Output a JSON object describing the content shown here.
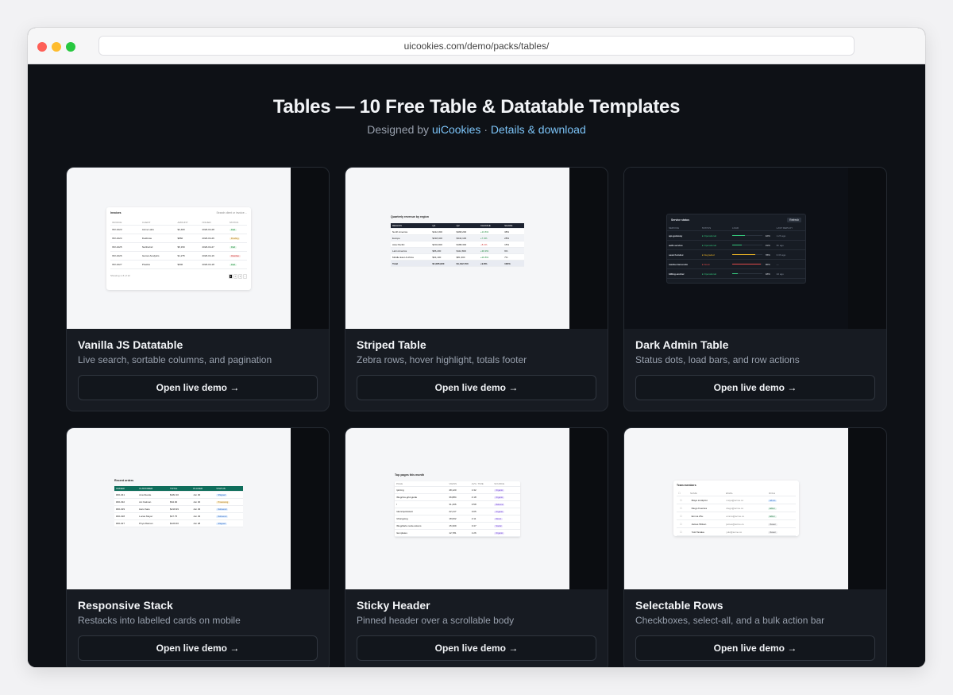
{
  "browser": {
    "url": "uicookies.com/demo/packs/tables/"
  },
  "header": {
    "title": "Tables — 10 Free Table & Datatable Templates",
    "designed_by": "Designed by",
    "brand_link": "uiCookies",
    "separator": "·",
    "details_link": "Details & download"
  },
  "cards": [
    {
      "title": "Vanilla JS Datatable",
      "desc": "Live search, sortable columns, and pagination",
      "button": "Open live demo →"
    },
    {
      "title": "Striped Table",
      "desc": "Zebra rows, hover highlight, totals footer",
      "button": "Open live demo →"
    },
    {
      "title": "Dark Admin Table",
      "desc": "Status dots, load bars, and row actions",
      "button": "Open live demo →"
    },
    {
      "title": "Responsive Stack",
      "desc": "Restacks into labelled cards on mobile",
      "button": "Open live demo →"
    },
    {
      "title": "Sticky Header",
      "desc": "Pinned header over a scrollable body",
      "button": "Open live demo →"
    },
    {
      "title": "Selectable Rows",
      "desc": "Checkboxes, select-all, and a bulk action bar",
      "button": "Open live demo →"
    }
  ],
  "previews": {
    "datatable": {
      "title": "Invoices",
      "search": "Search client or invoice…",
      "headers": [
        "INVOICE",
        "CLIENT",
        "AMOUNT",
        "ISSUED",
        "STATUS"
      ],
      "rows": [
        [
          "INV-1023",
          "Acme Labs",
          "$2,400",
          "2026-04-28",
          "Paid"
        ],
        [
          "INV-1024",
          "Fieldnote",
          "$860",
          "2026-04-26",
          "Pending"
        ],
        [
          "INV-1025",
          "Northwind",
          "$5,150",
          "2026-04-27",
          "Paid"
        ],
        [
          "INV-1026",
          "Gamut Analytics",
          "$1,275",
          "2026-04-16",
          "Overdue"
        ],
        [
          "INV-1027",
          "Pixelize",
          "$940",
          "2026-04-18",
          "Paid"
        ]
      ],
      "footer": "Showing 1–5 of 12",
      "pages": [
        "1",
        "2",
        "3",
        "›"
      ]
    },
    "striped": {
      "title": "Quarterly revenue by region",
      "headers": [
        "REGION",
        "Q1",
        "Q2",
        "CHANGE",
        "SHARE"
      ],
      "rows": [
        [
          "North America",
          "$412,300",
          "$468,200",
          "+13.6%",
          "38%"
        ],
        [
          "Europe",
          "$318,400",
          "$342,100",
          "+7.4%",
          "28%"
        ],
        [
          "Asia Pacific",
          "$204,900",
          "$188,300",
          "−8.1%",
          "15%"
        ],
        [
          "Latin America",
          "$86,200",
          "$112,800",
          "+30.9%",
          "9%"
        ],
        [
          "Middle East & Africa",
          "$64,100",
          "$81,300",
          "+26.8%",
          "7%"
        ]
      ],
      "total": [
        "Total",
        "$1,085,900",
        "$1,192,700",
        "+9.8%",
        "100%"
      ]
    },
    "dark": {
      "title": "Service status",
      "action": "Refresh",
      "headers": [
        "SERVICE",
        "STATUS",
        "LOAD",
        "",
        "LAST DEPLOY"
      ],
      "rows": [
        [
          "api-gateway",
          "Operational",
          "42%",
          "1.2h ago"
        ],
        [
          "auth-service",
          "Operational",
          "31%",
          "6h ago"
        ],
        [
          "search-index",
          "Degraded",
          "78%",
          "0.3h ago"
        ],
        [
          "media-transcode",
          "Down",
          "96%",
          "—"
        ],
        [
          "billing-worker",
          "Operational",
          "18%",
          "2d ago"
        ]
      ]
    },
    "responsive": {
      "title": "Recent orders",
      "headers": [
        "ORDER",
        "CUSTOMER",
        "TOTAL",
        "PLACED",
        "STATUS"
      ],
      "rows": [
        [
          "#00-341",
          "Ana Duarte",
          "$182.40",
          "Jun 30",
          "Shipped"
        ],
        [
          "#00-332",
          "Avi Kalman",
          "$64.00",
          "Jun 30",
          "Processing"
        ],
        [
          "#00-329",
          "Haru Sato",
          "$219.99",
          "Jun 29",
          "Delivered"
        ],
        [
          "#00-328",
          "Lucas Meyer",
          "$47.75",
          "Jun 29",
          "Delivered"
        ],
        [
          "#00-327",
          "Priya Raman",
          "$129.60",
          "Jun 28",
          "Shipped"
        ]
      ]
    },
    "sticky": {
      "title": "Top pages this month",
      "headers": [
        "PAGE",
        "VIEWS",
        "AVG. TIME",
        "SOURCE"
      ],
      "rows": [
        [
          "/pricing",
          "48,120",
          "1:32",
          "Organic"
        ],
        [
          "/blog/css-grid-guide",
          "36,884",
          "4:18",
          "Organic"
        ],
        [
          "/",
          "31,406",
          "0:58",
          "Referral"
        ],
        [
          "/docs/quickstart",
          "22,417",
          "3:05",
          "Organic"
        ],
        [
          "/changelog",
          "18,602",
          "2:11",
          "Direct"
        ],
        [
          "/blog/dark-mode-tokens",
          "15,309",
          "3:47",
          "Social"
        ],
        [
          "/templates",
          "12,781",
          "1:26",
          "Organic"
        ]
      ]
    },
    "selectable": {
      "title": "Team members",
      "headers": [
        "NAME",
        "EMAIL",
        "ROLE"
      ],
      "rows": [
        [
          "Maya Lindqvist",
          "maya@acme.co",
          "Admin"
        ],
        [
          "Diego Fuentes",
          "diego@acme.co",
          "Editor"
        ],
        [
          "Emma Zhu",
          "emma@acme.co",
          "Editor"
        ],
        [
          "James Wilson",
          "james@acme.co",
          "Viewer"
        ],
        [
          "Yuki Tanaka",
          "yuki@acme.co",
          "Viewer"
        ]
      ]
    }
  }
}
